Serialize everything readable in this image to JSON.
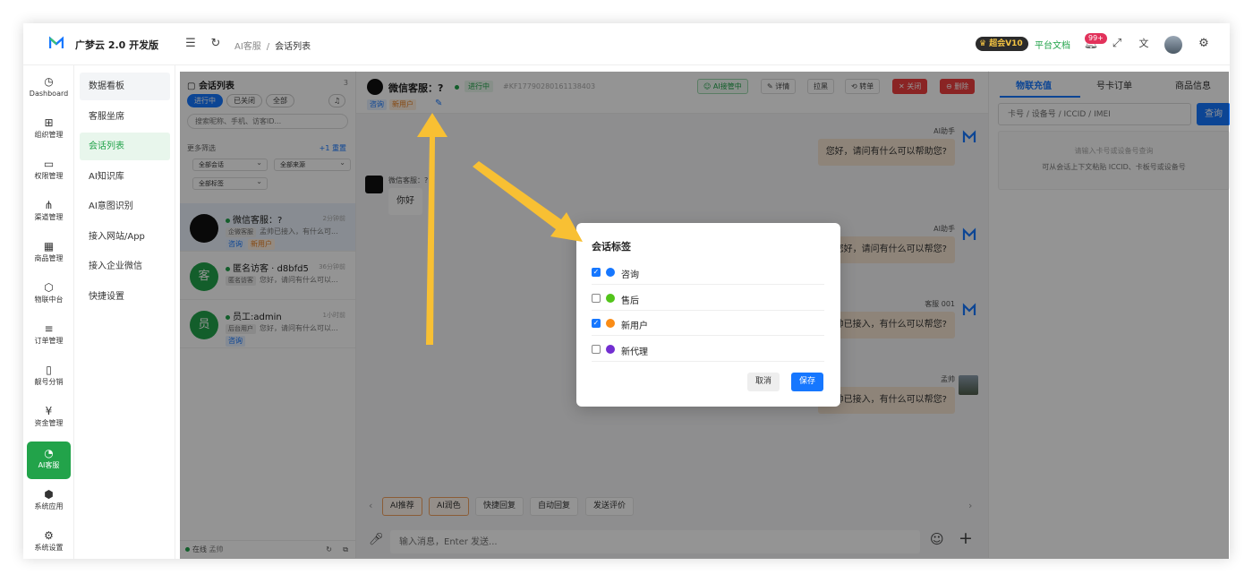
{
  "app": {
    "title": "广梦云 2.0 开发版"
  },
  "breadcrumb": {
    "parent": "AI客服",
    "separator": "/",
    "current": "会话列表"
  },
  "topbar": {
    "vip_label": "超会V10",
    "docs_label": "平台文档",
    "notification_badge": "99+"
  },
  "rail": {
    "items": [
      {
        "label": "Dashboard",
        "icon": "dashboard-icon"
      },
      {
        "label": "组织管理",
        "icon": "grid-icon"
      },
      {
        "label": "权限管理",
        "icon": "monitor-icon"
      },
      {
        "label": "渠道管理",
        "icon": "network-icon"
      },
      {
        "label": "商品管理",
        "icon": "store-icon"
      },
      {
        "label": "物联中台",
        "icon": "cube-icon"
      },
      {
        "label": "订单管理",
        "icon": "list-icon"
      },
      {
        "label": "靓号分销",
        "icon": "phone-icon"
      },
      {
        "label": "资金管理",
        "icon": "wallet-icon"
      },
      {
        "label": "AI客服",
        "icon": "ai-icon"
      },
      {
        "label": "系统应用",
        "icon": "apps-icon"
      },
      {
        "label": "系统设置",
        "icon": "settings-icon"
      }
    ]
  },
  "submenu": {
    "items": [
      "数据看板",
      "客服坐席",
      "会话列表",
      "AI知识库",
      "AI意图识别",
      "接入网站/App",
      "接入企业微信",
      "快捷设置"
    ]
  },
  "conversations": {
    "title": "会话列表",
    "count": "3",
    "filters": [
      "进行中",
      "已关闭",
      "全部"
    ],
    "search_placeholder": "搜索昵称、手机、访客ID...",
    "more_filters": "更多筛选",
    "more_filters_action": "+1  重置",
    "selects": [
      "全部会话",
      "全部来源",
      "全部标签"
    ],
    "items": [
      {
        "name": "微信客服：?",
        "time": "2分钟前",
        "source": "企微客服",
        "preview": "孟帅已接入，有什么可...",
        "tags": [
          "咨询",
          "新用户"
        ],
        "avatar_text": ""
      },
      {
        "name": "匿名访客 · d8bfd5",
        "time": "36分钟前",
        "source": "匿名访客",
        "preview": "您好，请问有什么可以...",
        "tags": [],
        "avatar_text": "客"
      },
      {
        "name": "员工:admin",
        "time": "1小时前",
        "source": "后台用户",
        "preview": "您好，请问有什么可以...",
        "tags": [
          "咨询"
        ],
        "avatar_text": "员"
      }
    ],
    "footer_status": "在线",
    "footer_user": "孟帅"
  },
  "chat": {
    "title": "微信客服：?",
    "status": "进行中",
    "session_id": "#KF17790280161138403",
    "tags": [
      "咨询",
      "新用户"
    ],
    "actions": [
      "AI接管中",
      "详情",
      "拉黑",
      "转单",
      "关闭",
      "删除"
    ],
    "messages": [
      {
        "sender": "AI助手",
        "text": "您好，请问有什么可以帮助您?",
        "dir": "out"
      },
      {
        "sender": "微信客服：?",
        "text": "你好",
        "dir": "in"
      },
      {
        "sender": "AI助手",
        "text": "您好，请问有什么可以帮您?",
        "dir": "out"
      },
      {
        "sender": "客服 001",
        "text": "孟帅已接入，有什么可以帮您?",
        "dir": "out"
      },
      {
        "sender": "孟帅",
        "text": "孟帅已接入，有什么可以帮您?",
        "dir": "out"
      }
    ],
    "quick_actions": [
      "AI推荐",
      "AI润色",
      "快捷回复",
      "自动回复",
      "发送评价"
    ],
    "input_placeholder": "输入消息，Enter 发送..."
  },
  "right_panel": {
    "tabs": [
      "物联充值",
      "号卡订单",
      "商品信息"
    ],
    "search_placeholder": "卡号 / 设备号 / ICCID / IMEI",
    "search_button": "查询",
    "hint_line1": "请输入卡号或设备号查询",
    "hint_line2": "可从会话上下文粘贴 ICCID、卡板号或设备号"
  },
  "modal": {
    "title": "会话标签",
    "options": [
      {
        "label": "咨询",
        "checked": true,
        "color": "#1677ff"
      },
      {
        "label": "售后",
        "checked": false,
        "color": "#52c41a"
      },
      {
        "label": "新用户",
        "checked": true,
        "color": "#fa8c16"
      },
      {
        "label": "新代理",
        "checked": false,
        "color": "#722ed1"
      }
    ],
    "cancel_label": "取消",
    "save_label": "保存"
  },
  "colors": {
    "accent": "#22a34a",
    "primary": "#1677ff",
    "danger": "#ee3e3e",
    "annotation_arrow": "#f8c033"
  }
}
